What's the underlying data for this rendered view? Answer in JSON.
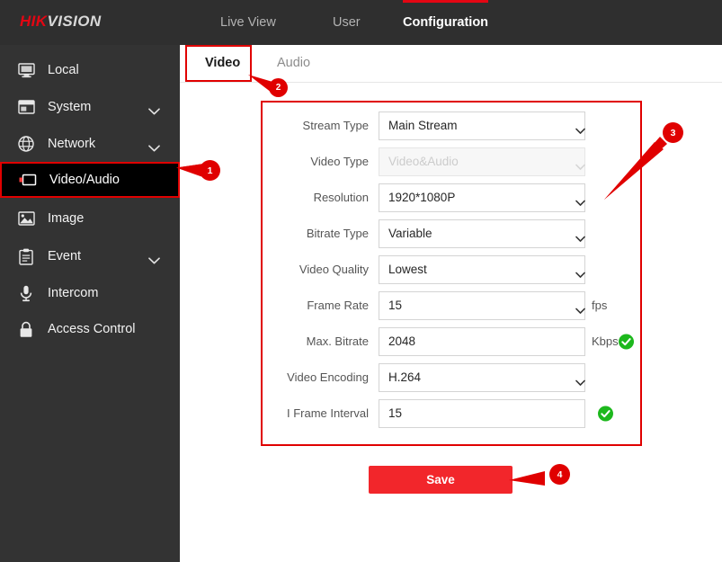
{
  "header": {
    "logo_hik": "HIK",
    "logo_vision": "VISION",
    "nav": [
      {
        "label": "Live View",
        "active": false
      },
      {
        "label": "User",
        "active": false
      },
      {
        "label": "Configuration",
        "active": true
      }
    ]
  },
  "sidebar": {
    "items": [
      {
        "label": "Local",
        "icon": "monitor-icon",
        "expandable": false,
        "selected": false
      },
      {
        "label": "System",
        "icon": "window-icon",
        "expandable": true,
        "selected": false
      },
      {
        "label": "Network",
        "icon": "globe-icon",
        "expandable": true,
        "selected": false
      },
      {
        "label": "Video/Audio",
        "icon": "video-camera-icon",
        "expandable": false,
        "selected": true
      },
      {
        "label": "Image",
        "icon": "picture-icon",
        "expandable": false,
        "selected": false
      },
      {
        "label": "Event",
        "icon": "clipboard-icon",
        "expandable": true,
        "selected": false
      },
      {
        "label": "Intercom",
        "icon": "microphone-icon",
        "expandable": false,
        "selected": false
      },
      {
        "label": "Access Control",
        "icon": "lock-icon",
        "expandable": false,
        "selected": false
      }
    ]
  },
  "tabs": [
    {
      "label": "Video",
      "active": true
    },
    {
      "label": "Audio",
      "active": false
    }
  ],
  "form": {
    "fields": [
      {
        "label": "Stream Type",
        "value": "Main Stream",
        "type": "select",
        "disabled": false,
        "unit": "",
        "valid": false
      },
      {
        "label": "Video Type",
        "value": "Video&Audio",
        "type": "select",
        "disabled": true,
        "unit": "",
        "valid": false
      },
      {
        "label": "Resolution",
        "value": "1920*1080P",
        "type": "select",
        "disabled": false,
        "unit": "",
        "valid": false
      },
      {
        "label": "Bitrate Type",
        "value": "Variable",
        "type": "select",
        "disabled": false,
        "unit": "",
        "valid": false
      },
      {
        "label": "Video Quality",
        "value": "Lowest",
        "type": "select",
        "disabled": false,
        "unit": "",
        "valid": false
      },
      {
        "label": "Frame Rate",
        "value": "15",
        "type": "select",
        "disabled": false,
        "unit": "fps",
        "valid": false
      },
      {
        "label": "Max. Bitrate",
        "value": "2048",
        "type": "text",
        "disabled": false,
        "unit": "Kbps",
        "valid": true
      },
      {
        "label": "Video Encoding",
        "value": "H.264",
        "type": "select",
        "disabled": false,
        "unit": "",
        "valid": false
      },
      {
        "label": "I Frame Interval",
        "value": "15",
        "type": "text",
        "disabled": false,
        "unit": "",
        "valid": true
      }
    ]
  },
  "save_button": {
    "label": "Save"
  },
  "annotations": [
    {
      "num": "1",
      "target": "video-audio-sidebar-item"
    },
    {
      "num": "2",
      "target": "video-tab"
    },
    {
      "num": "3",
      "target": "video-settings-form"
    },
    {
      "num": "4",
      "target": "save-button"
    }
  ],
  "colors": {
    "brand_red": "#e30613",
    "annotation_red": "#e00000",
    "save_red": "#f2262b",
    "header_dark": "#2f2f2f",
    "sidebar_dark": "#333333",
    "valid_green": "#1db81d"
  }
}
